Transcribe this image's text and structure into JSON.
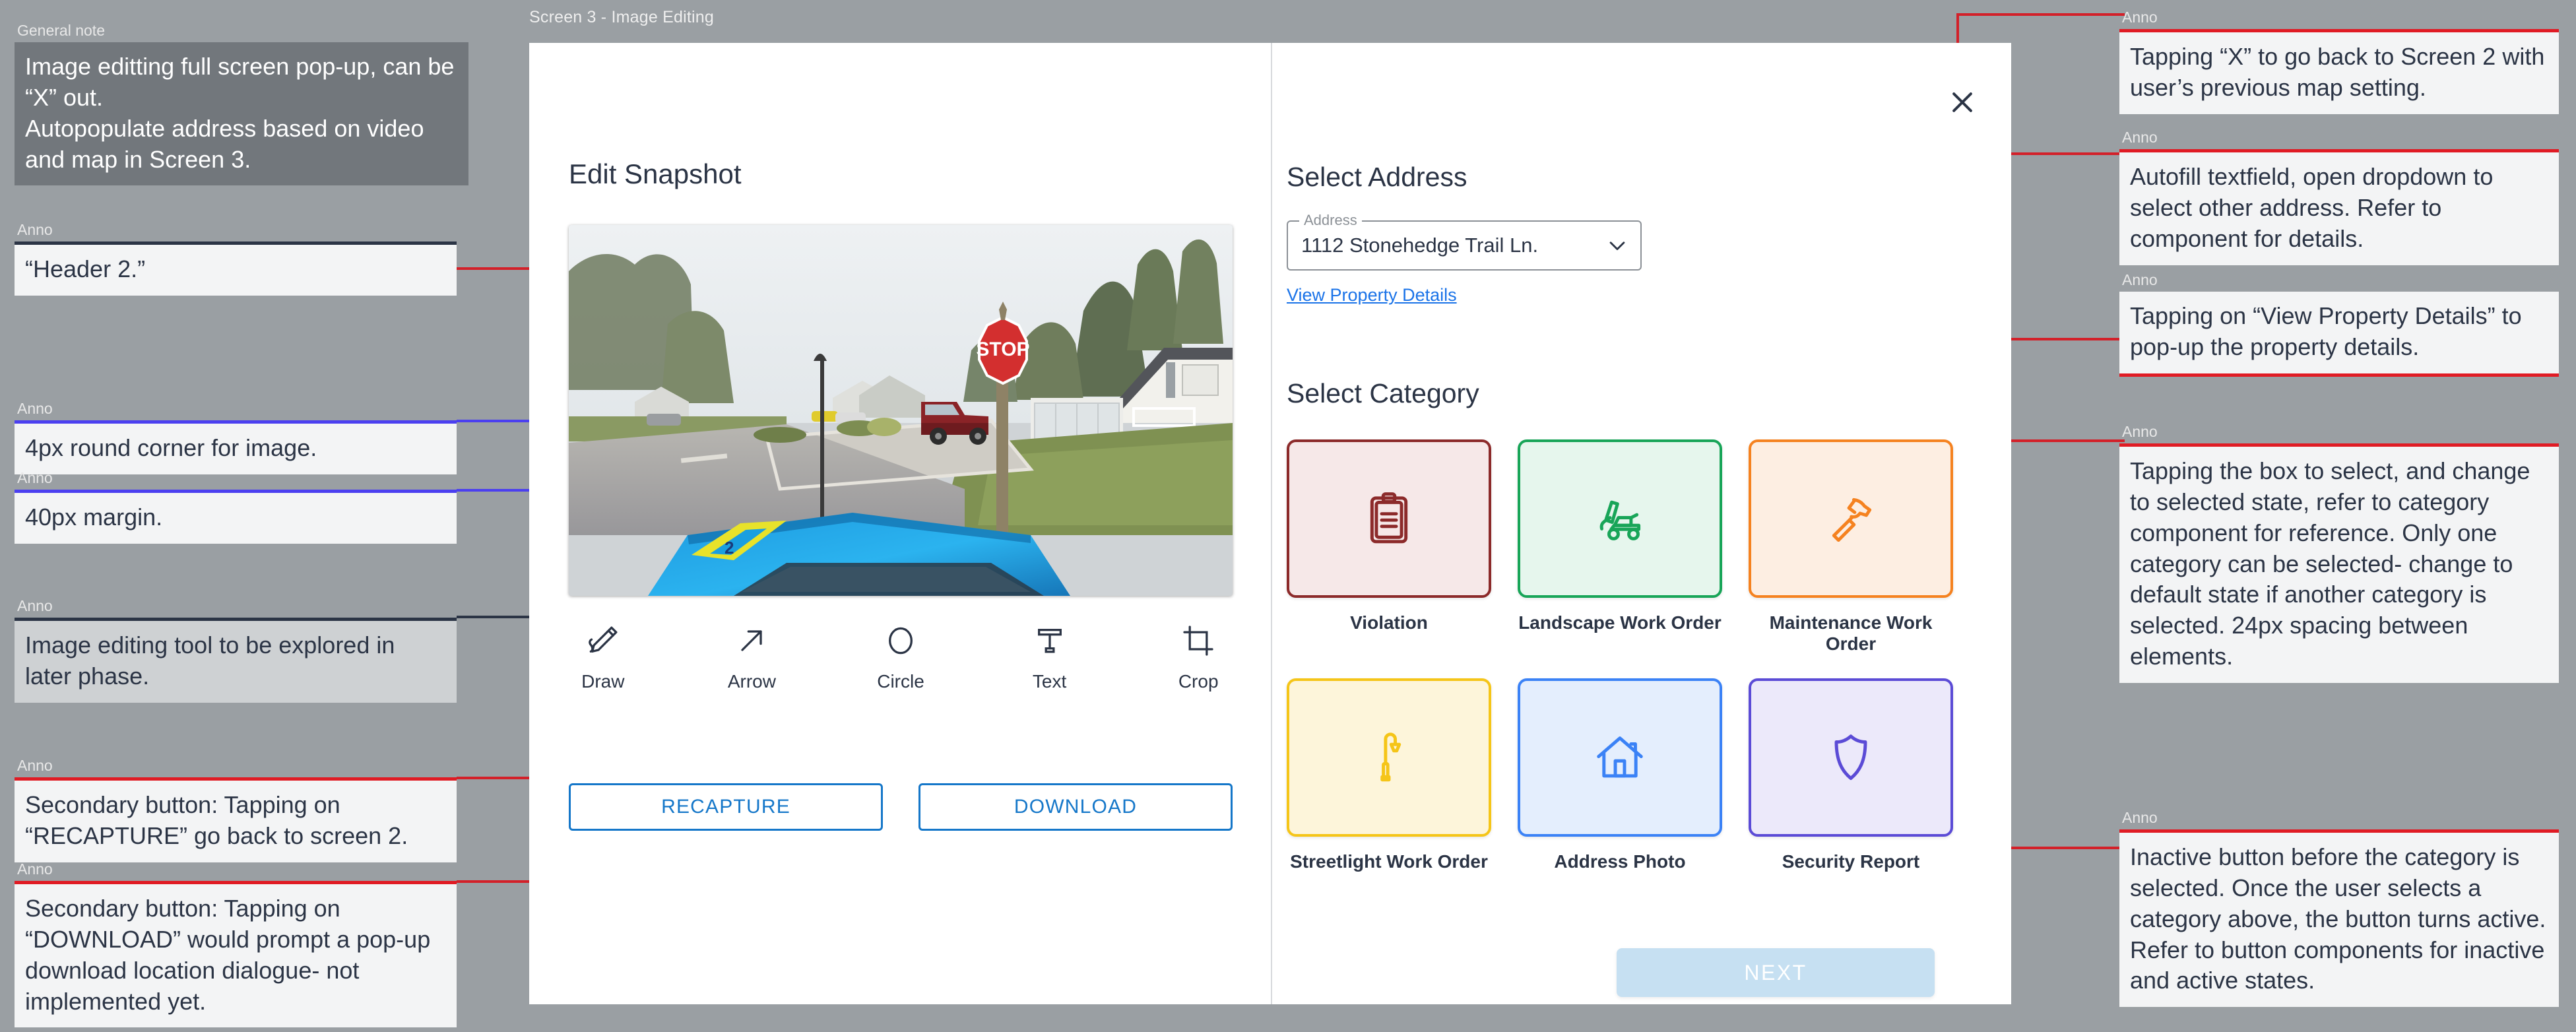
{
  "screen": {
    "title": "Screen 3 - Image Editing",
    "close_icon": "close-x-icon"
  },
  "left_panel": {
    "heading": "Edit Snapshot",
    "tools": [
      {
        "icon": "pencil-draw-icon",
        "label": "Draw"
      },
      {
        "icon": "arrow-up-right-icon",
        "label": "Arrow"
      },
      {
        "icon": "circle-outline-icon",
        "label": "Circle"
      },
      {
        "icon": "text-t-icon",
        "label": "Text"
      },
      {
        "icon": "crop-icon",
        "label": "Crop"
      }
    ],
    "buttons": {
      "recapture": "RECAPTURE",
      "download": "DOWNLOAD"
    }
  },
  "right_panel": {
    "address_section_title": "Select Address",
    "address_field": {
      "legend": "Address",
      "value": "1112 Stonehedge Trail Ln.",
      "chevron_icon": "chevron-down-icon"
    },
    "property_link": "View Property Details",
    "category_section_title": "Select Category",
    "categories": [
      {
        "label": "Violation",
        "icon": "clipboard-icon",
        "border": "#8c2a2a",
        "fill": "#f6e8e8",
        "stroke": "#8c2a2a"
      },
      {
        "label": "Landscape Work Order",
        "icon": "lawnmower-icon",
        "border": "#18a558",
        "fill": "#e6f6ed",
        "stroke": "#18a558"
      },
      {
        "label": "Maintenance Work Order",
        "icon": "hammer-icon",
        "border": "#f58220",
        "fill": "#fdeee2",
        "stroke": "#f58220"
      },
      {
        "label": "Streetlight Work Order",
        "icon": "streetlight-icon",
        "border": "#f5c518",
        "fill": "#fdf5da",
        "stroke": "#f5c518"
      },
      {
        "label": "Address Photo",
        "icon": "house-icon",
        "border": "#3b82f6",
        "fill": "#e4eefd",
        "stroke": "#3b82f6"
      },
      {
        "label": "Security Report",
        "icon": "shield-icon",
        "border": "#5b4bd6",
        "fill": "#ece9fa",
        "stroke": "#5b4bd6"
      }
    ],
    "next_button": "NEXT"
  },
  "annotations": {
    "general_note": {
      "label": "General note",
      "text": "Image editting full screen pop-up, can be “X” out.\nAutopopulate address based on video and map in Screen 3."
    },
    "left": [
      {
        "label": "Anno",
        "text": "“Header 2.”"
      },
      {
        "label": "Anno",
        "text": "4px round corner for image."
      },
      {
        "label": "Anno",
        "text": "40px margin."
      },
      {
        "label": "Anno",
        "text": "Image editing tool to be explored in later phase."
      },
      {
        "label": "Anno",
        "text": "Secondary button: Tapping on “RECAPTURE” go back to screen 2."
      },
      {
        "label": "Anno",
        "text": "Secondary button: Tapping on “DOWNLOAD” would prompt a pop-up download location dialogue- not implemented yet."
      }
    ],
    "right": [
      {
        "label": "Anno",
        "text": "Tapping “X” to go back to Screen 2 with user’s previous map setting."
      },
      {
        "label": "Anno",
        "text": "Autofill textfield, open dropdown to select other address. Refer to component for details."
      },
      {
        "label": "Anno",
        "text": "Tapping on “View Property Details” to pop-up the property details."
      },
      {
        "label": "Anno",
        "text": "Tapping the box to select, and change to selected state, refer to category component for reference. Only one category can be selected- change to default state if another category is selected. 24px spacing between elements."
      },
      {
        "label": "Anno",
        "text": "Inactive button before the category is selected. Once the user selects a category above, the button turns active. Refer to button components for inactive and active states."
      }
    ]
  },
  "colors": {
    "annotation_red": "#e01b24",
    "annotation_blue": "#4b3ff0",
    "annotation_dark": "#2b3445",
    "link_blue": "#1a73e8",
    "secondary_button": "#1577c9",
    "next_inactive": "#c6e0f2"
  }
}
